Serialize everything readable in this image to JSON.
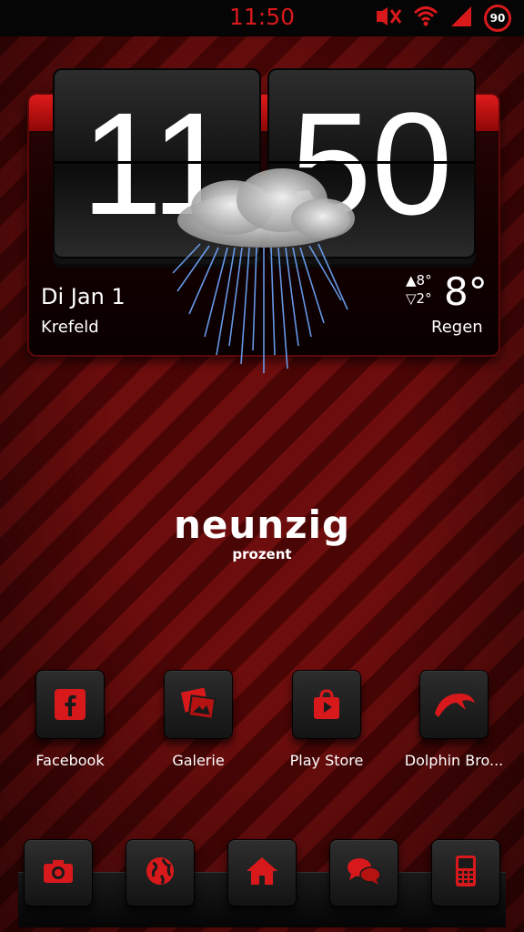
{
  "status_bar": {
    "time": "11:50",
    "battery_level": "90",
    "icons": [
      "mute-icon",
      "wifi-icon",
      "signal-icon",
      "battery-icon"
    ],
    "accent_color": "#d8191c"
  },
  "clock_widget": {
    "hour": "11",
    "minute": "50",
    "date": "Di Jan 1",
    "location": "Krefeld",
    "high_temp": "▲8°",
    "low_temp": "▽2°",
    "current_temp": "8°",
    "condition": "Regen",
    "weather_icon": "rain-cloud-icon"
  },
  "brand": {
    "title": "neunzig",
    "subtitle": "prozent"
  },
  "apps": [
    {
      "label": "Facebook",
      "icon": "facebook-icon"
    },
    {
      "label": "Galerie",
      "icon": "gallery-icon"
    },
    {
      "label": "Play Store",
      "icon": "play-store-icon"
    },
    {
      "label": "Dolphin Bro...",
      "icon": "dolphin-icon"
    }
  ],
  "dock": [
    {
      "icon": "camera-icon"
    },
    {
      "icon": "globe-icon"
    },
    {
      "icon": "home-icon"
    },
    {
      "icon": "messages-icon"
    },
    {
      "icon": "phone-icon"
    }
  ]
}
